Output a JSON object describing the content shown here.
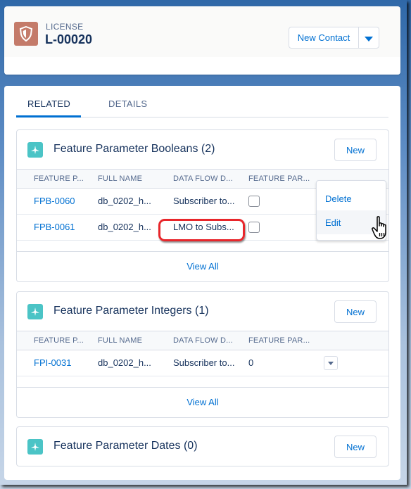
{
  "header": {
    "record_type": "LICENSE",
    "record_name": "L-00020",
    "record_icon": "license-shield-icon",
    "primary_action": "New Contact",
    "menu_icon": "chevron-down-icon"
  },
  "tabs": [
    {
      "label": "RELATED",
      "active": true
    },
    {
      "label": "DETAILS",
      "active": false
    }
  ],
  "columns": [
    "FEATURE P...",
    "FULL NAME",
    "DATA FLOW D...",
    "FEATURE PAR..."
  ],
  "related_lists": [
    {
      "title": "Feature Parameter Booleans (2)",
      "icon": "feature-parameter-icon",
      "new_label": "New",
      "rows": [
        {
          "id": "FPB-0060",
          "full_name": "db_0202_h...",
          "data_flow": "Subscriber to...",
          "value_type": "checkbox",
          "checked": false
        },
        {
          "id": "FPB-0061",
          "full_name": "db_0202_h...",
          "data_flow": "LMO to Subs...",
          "value_type": "checkbox",
          "checked": false
        }
      ],
      "view_all": "View All"
    },
    {
      "title": "Feature Parameter Integers (1)",
      "icon": "feature-parameter-icon",
      "new_label": "New",
      "rows": [
        {
          "id": "FPI-0031",
          "full_name": "db_0202_h...",
          "data_flow": "Subscriber to...",
          "value": "0"
        }
      ],
      "view_all": "View All"
    },
    {
      "title": "Feature Parameter Dates (0)",
      "icon": "feature-parameter-icon",
      "new_label": "New"
    }
  ],
  "row_menu": {
    "items": [
      "Delete",
      "Edit"
    ],
    "hovered": "Edit"
  },
  "colors": {
    "brand_blue": "#0070d2",
    "license_icon_bg": "#c47b6a",
    "feature_icon_bg": "#4bc4c6",
    "highlight_red": "#e8262b",
    "text_primary": "#16325c",
    "text_secondary": "#54698d"
  }
}
